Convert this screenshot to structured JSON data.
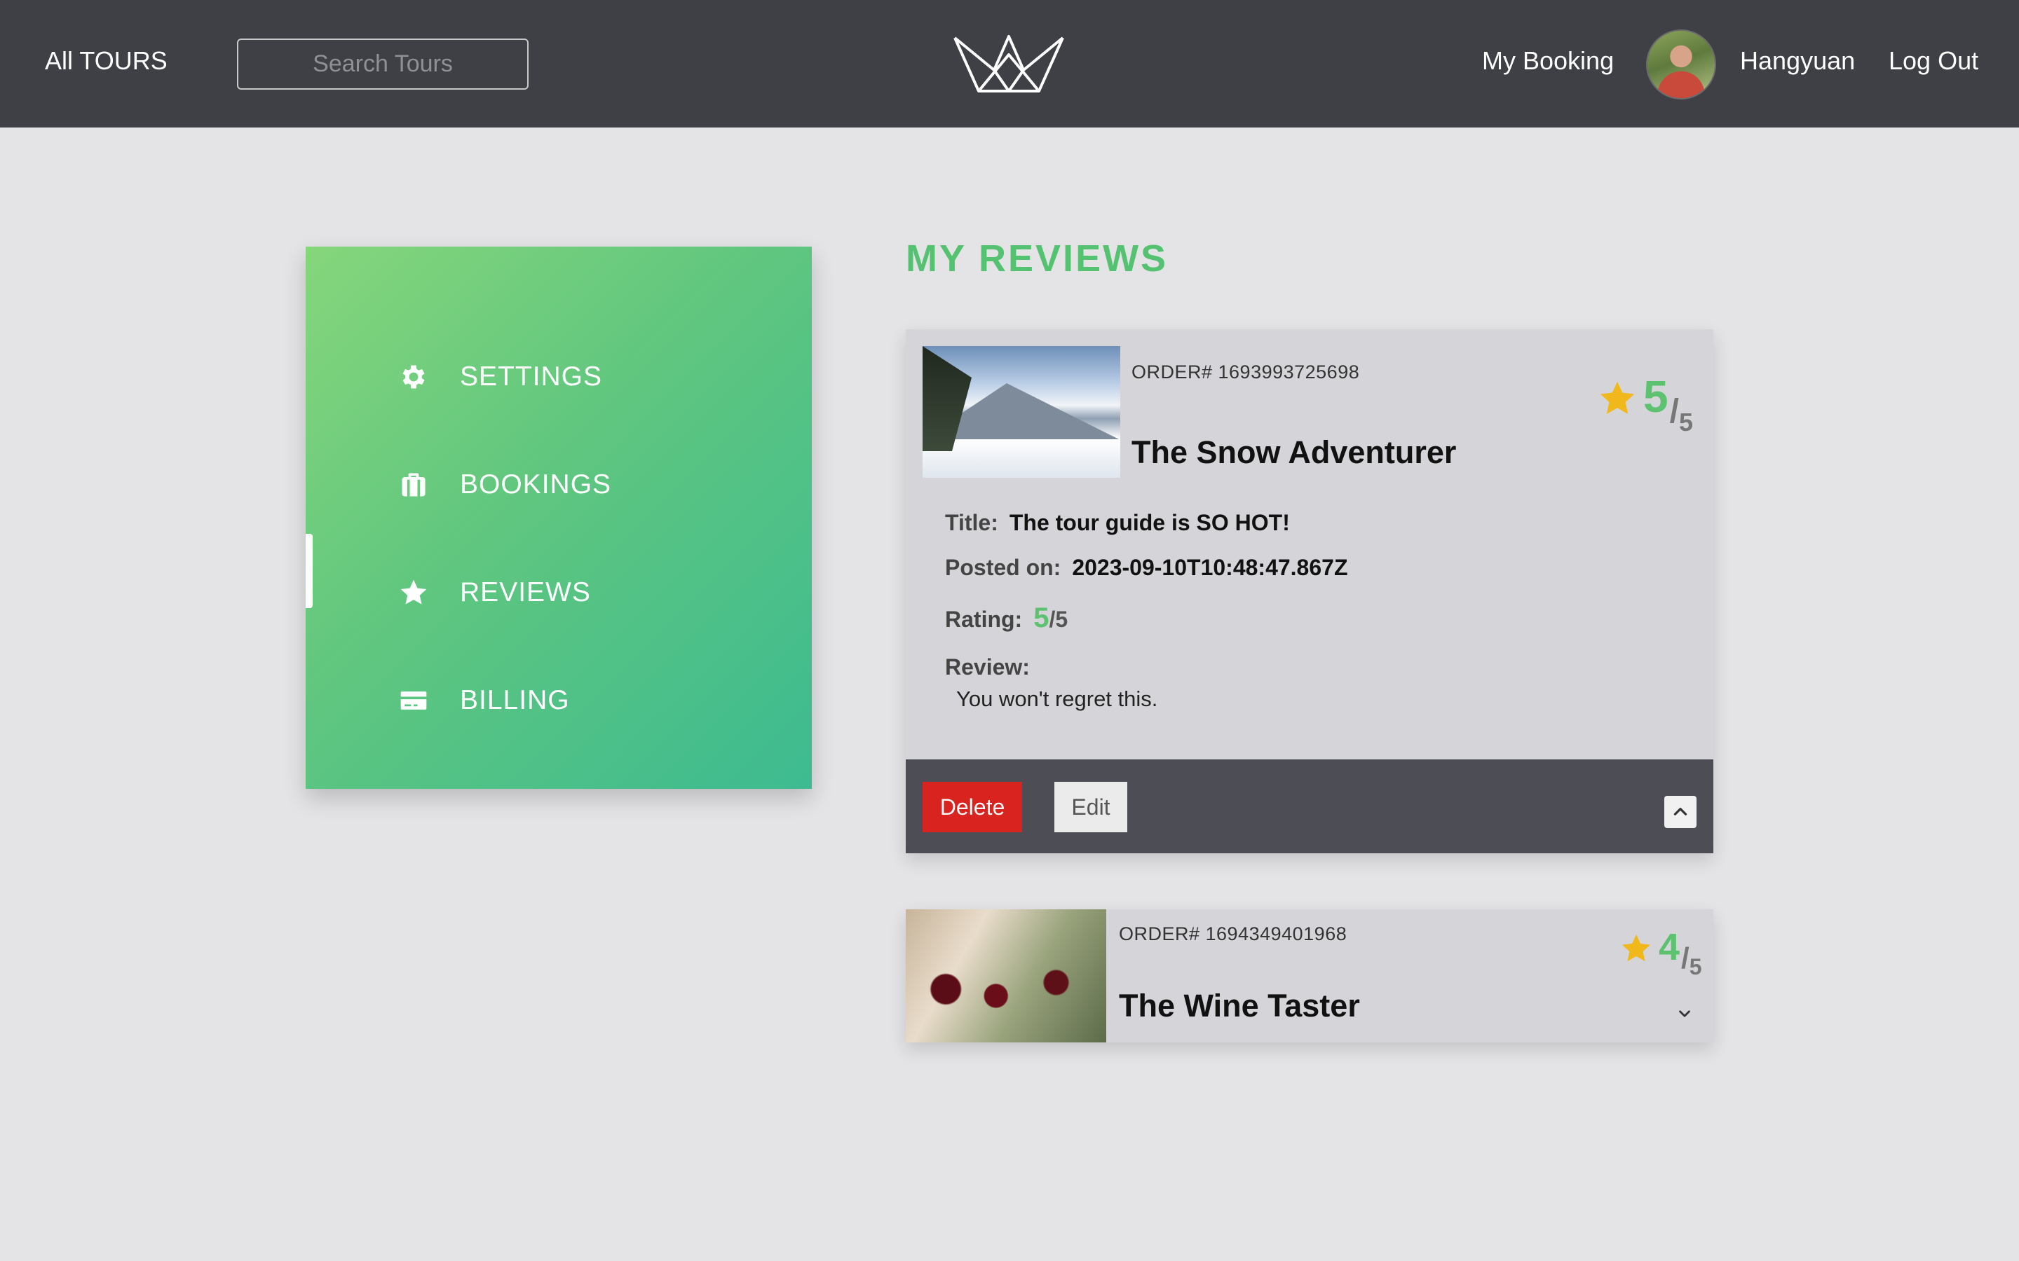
{
  "header": {
    "all_tours": "All TOURS",
    "search_placeholder": "Search Tours",
    "my_booking": "My Booking",
    "user_name": "Hangyuan",
    "logout": "Log Out"
  },
  "sidebar": {
    "items": [
      {
        "label": "SETTINGS",
        "icon": "gear-icon"
      },
      {
        "label": "BOOKINGS",
        "icon": "suitcase-icon"
      },
      {
        "label": "REVIEWS",
        "icon": "star-icon",
        "active": true
      },
      {
        "label": "BILLING",
        "icon": "credit-card-icon"
      }
    ]
  },
  "main": {
    "title": "MY REVIEWS",
    "reviews": [
      {
        "order": "ORDER# 1693993725698",
        "tour_name": "The Snow Adventurer",
        "score": "5",
        "score_den": "5",
        "title_label": "Title:",
        "title": "The tour guide is SO HOT!",
        "posted_label": "Posted on:",
        "posted": "2023-09-10T10:48:47.867Z",
        "rating_label": "Rating:",
        "rating": "5",
        "rating_den": "/5",
        "review_label": "Review:",
        "review": "You won't regret this.",
        "delete_label": "Delete",
        "edit_label": "Edit",
        "expanded": true
      },
      {
        "order": "ORDER# 1694349401968",
        "tour_name": "The Wine Taster",
        "score": "4",
        "score_den": "5",
        "expanded": false
      }
    ]
  },
  "colors": {
    "header_bg": "#3f4046",
    "accent_green": "#55c271",
    "star_yellow": "#f0b81a",
    "delete_red": "#d9231f"
  }
}
